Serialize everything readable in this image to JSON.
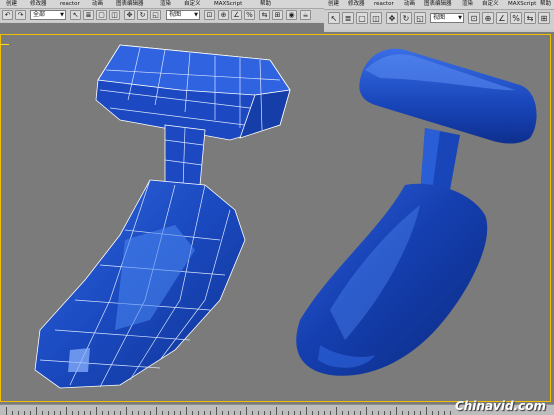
{
  "left_window": {
    "menu": [
      "创建",
      "修改器",
      "reactor",
      "动画",
      "图表编辑器",
      "渲染",
      "自定义",
      "MAXScript",
      "帮助"
    ],
    "selection_filter": "全部",
    "view_dropdown": "视图"
  },
  "right_window": {
    "menu": [
      "创建",
      "修改器",
      "reactor",
      "动画",
      "图表编辑器",
      "渲染",
      "自定义",
      "MAXScript",
      "帮助"
    ],
    "view_dropdown": "视图"
  },
  "watermark": "Chinavid.com",
  "colors": {
    "viewport_bg": "#7b7b7b",
    "model_blue": "#1846b8",
    "wire": "#c9d8ff",
    "viewport_border": "#f0c000"
  },
  "icons": {
    "toolbar": [
      "select-icon",
      "select-region-icon",
      "move-icon",
      "rotate-icon",
      "scale-icon",
      "mirror-icon",
      "align-icon",
      "material-icon",
      "render-icon",
      "snap-icon"
    ]
  }
}
